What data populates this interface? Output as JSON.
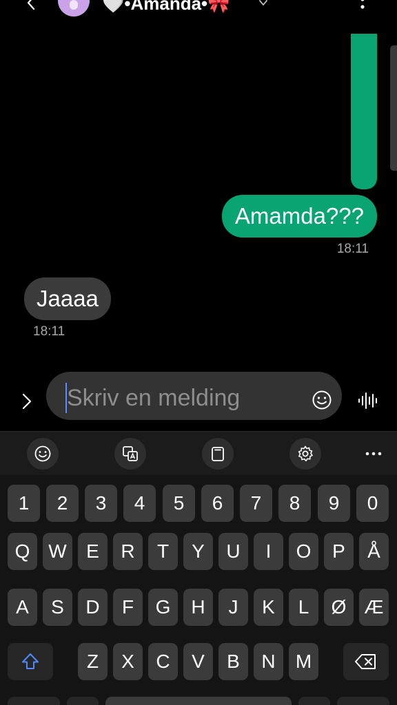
{
  "header": {
    "contact_name": "🤍•Amanda•🎀"
  },
  "messages": {
    "sent": {
      "text": "Amamda???",
      "time": "18:11"
    },
    "received": {
      "text": "Jaaaa",
      "time": "18:11"
    }
  },
  "composer": {
    "placeholder": "Skriv en melding"
  },
  "keyboard": {
    "row_numbers": [
      "1",
      "2",
      "3",
      "4",
      "5",
      "6",
      "7",
      "8",
      "9",
      "0"
    ],
    "row_1": [
      "Q",
      "W",
      "E",
      "R",
      "T",
      "Y",
      "U",
      "I",
      "O",
      "P",
      "Å"
    ],
    "row_2": [
      "A",
      "S",
      "D",
      "F",
      "G",
      "H",
      "J",
      "K",
      "L",
      "Ø",
      "Æ"
    ],
    "row_3": [
      "Z",
      "X",
      "C",
      "V",
      "B",
      "N",
      "M"
    ]
  },
  "colors": {
    "sent_bubble": "#0aa372",
    "received_bubble": "#3b3b3b",
    "background": "#000000",
    "key": "#3b3b3b",
    "accent_caret": "#5a8cff"
  },
  "icons": {
    "header": [
      "back-icon",
      "avatar",
      "chevron-down-icon",
      "more-icon"
    ],
    "composer": [
      "expand-icon",
      "emoji-icon",
      "voice-input-icon"
    ],
    "toolbar": [
      "emoji-icon",
      "translate-icon",
      "clipboard-icon",
      "settings-icon",
      "more-icon"
    ],
    "keys": [
      "shift-icon",
      "backspace-icon"
    ]
  }
}
